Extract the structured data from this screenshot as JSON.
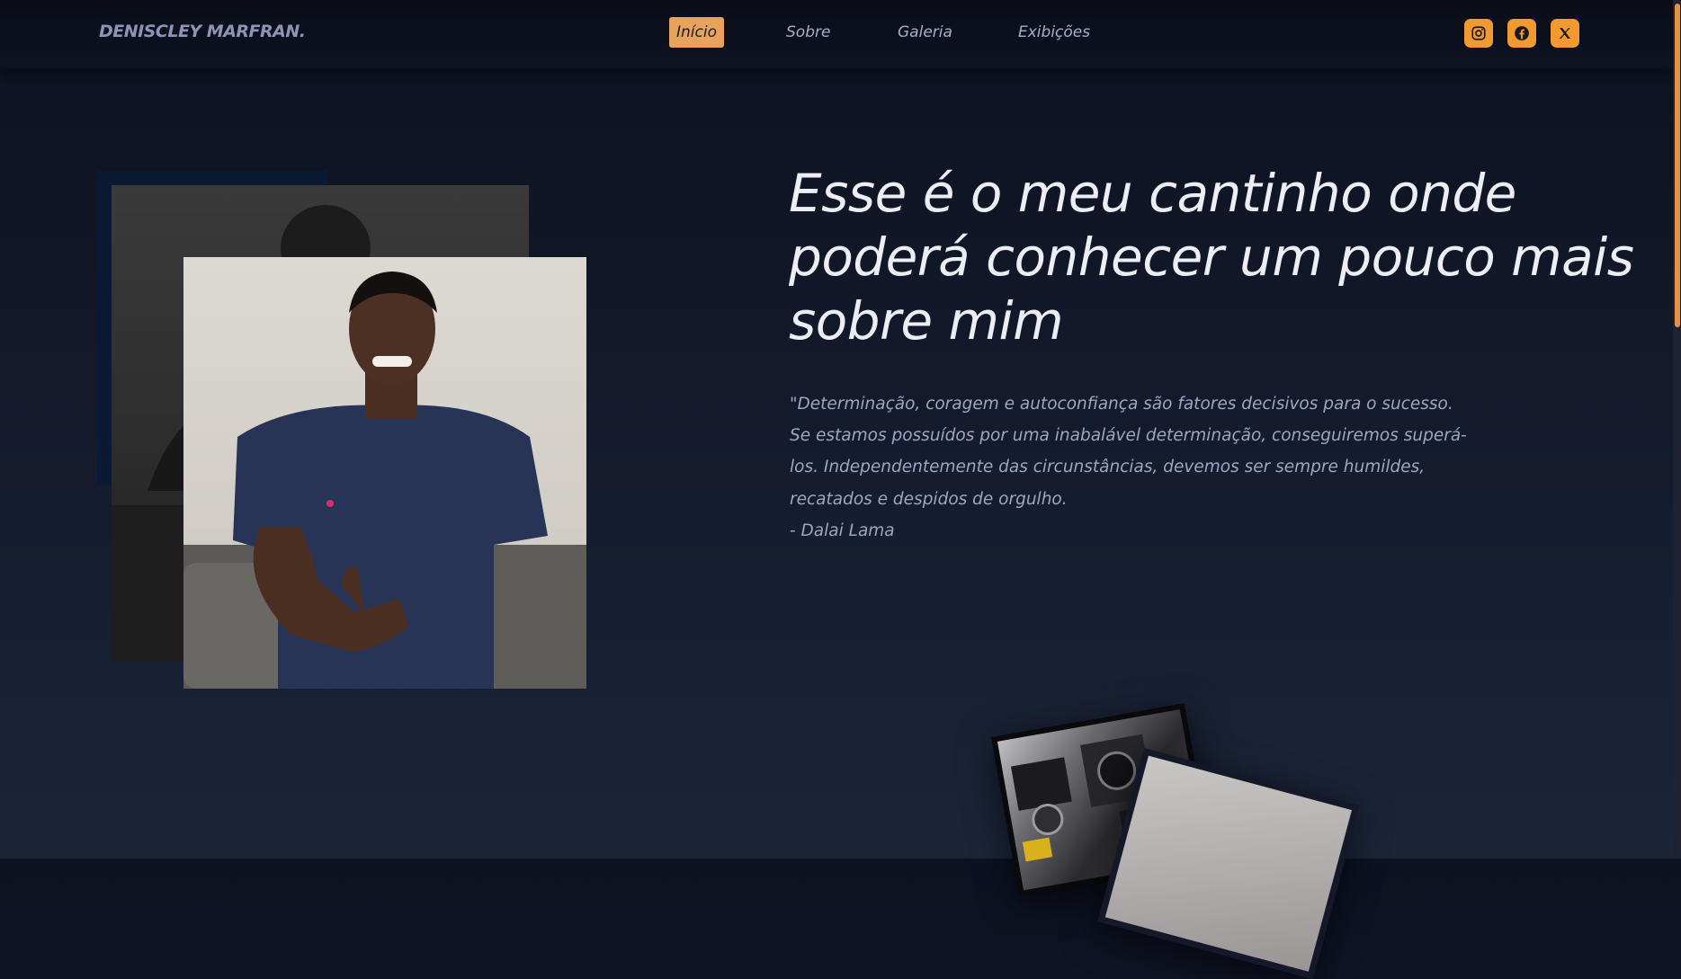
{
  "header": {
    "logo": "DENISCLEY MARFRAN.",
    "nav": [
      {
        "label": "Início",
        "active": true
      },
      {
        "label": "Sobre",
        "active": false
      },
      {
        "label": "Galeria",
        "active": false
      },
      {
        "label": "Exibições",
        "active": false
      }
    ],
    "social": [
      {
        "icon": "instagram-icon"
      },
      {
        "icon": "facebook-icon"
      },
      {
        "icon": "x-twitter-icon"
      }
    ]
  },
  "hero": {
    "title": "Esse é o meu cantinho onde poderá conhecer um pouco mais sobre mim",
    "quote": "\"Determinação, coragem e autoconfiança são fatores decisivos para o sucesso. Se estamos possuídos por uma inabalável determinação, conseguiremos superá-los. Independentemente das circunstâncias, devemos ser sempre humildes, recatados e despidos de orgulho.",
    "author": "- Dalai Lama"
  },
  "colors": {
    "accent": "#e7a25b",
    "social_bg": "#f29a30",
    "background": "#141a2c"
  }
}
